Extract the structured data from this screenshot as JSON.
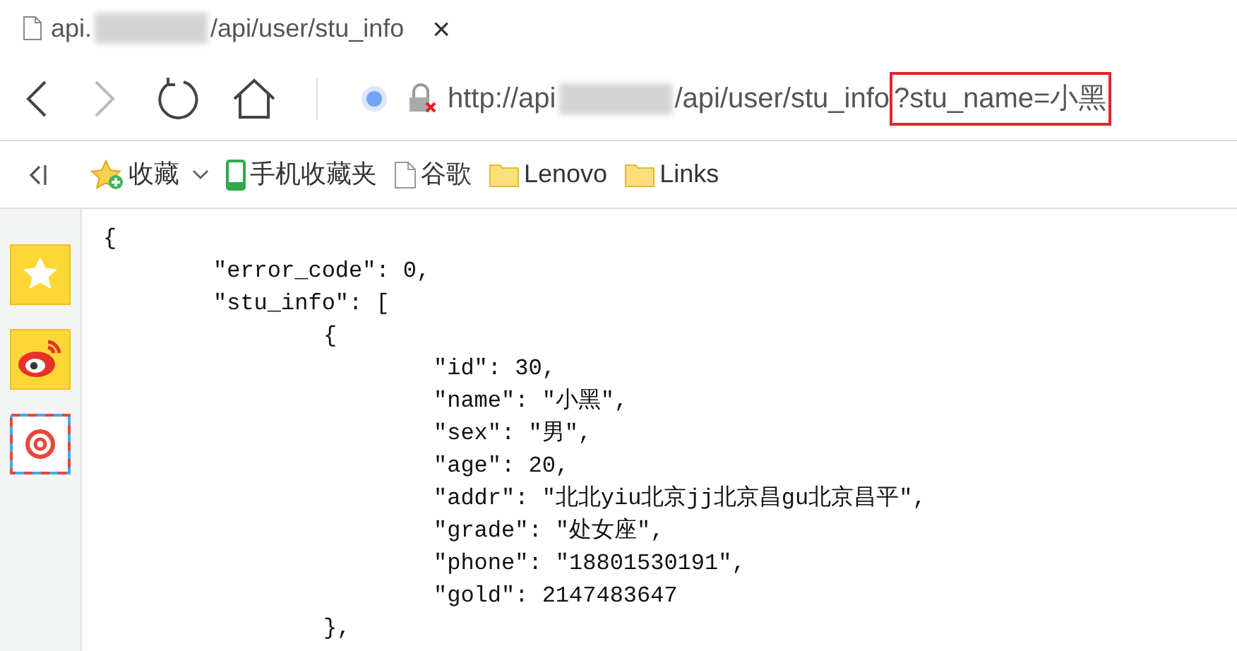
{
  "tab": {
    "title_start": "api.",
    "title_end": "/api/user/stu_info",
    "close": "×"
  },
  "address_bar": {
    "scheme_host": "http://api",
    "path": "/api/user/stu_info",
    "highlighted_query": "?stu_name=小黑"
  },
  "bookmarks": [
    {
      "kind": "favorites",
      "label": "收藏"
    },
    {
      "kind": "phone",
      "label": "手机收藏夹"
    },
    {
      "kind": "page",
      "label": "谷歌"
    },
    {
      "kind": "folder",
      "label": "Lenovo"
    },
    {
      "kind": "folder",
      "label": "Links"
    }
  ],
  "sidebar": [
    {
      "kind": "star"
    },
    {
      "kind": "weibo"
    },
    {
      "kind": "mail"
    }
  ],
  "json_view": [
    {
      "text": "{",
      "children": [
        {
          "text": "\"error_code\": 0,"
        },
        {
          "text": "\"stu_info\": [",
          "children": [
            {
              "text": "{",
              "children": [
                {
                  "text": "\"id\": 30,"
                },
                {
                  "text": "\"name\": \"小黑\","
                },
                {
                  "text": "\"sex\": \"男\","
                },
                {
                  "text": "\"age\": 20,"
                },
                {
                  "text": "\"addr\": \"北北yiu北京jj北京昌gu北京昌平\","
                },
                {
                  "text": "\"grade\": \"处女座\","
                },
                {
                  "text": "\"phone\": \"18801530191\","
                },
                {
                  "text": "\"gold\": 2147483647"
                }
              ]
            },
            {
              "text": "},"
            }
          ]
        }
      ]
    }
  ]
}
